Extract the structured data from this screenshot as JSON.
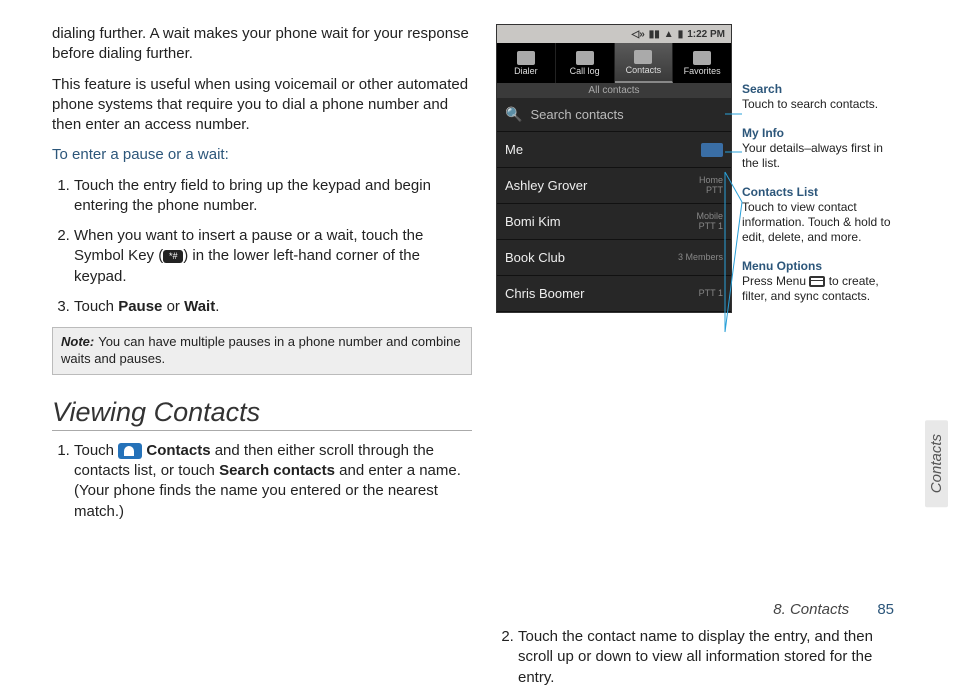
{
  "left": {
    "p1": "dialing further. A wait makes your phone wait for your response before dialing further.",
    "p2": "This feature is useful when using voicemail or other automated phone systems that require you to dial a phone number and then enter an access number.",
    "instr": "To enter a pause or a wait:",
    "steps": [
      "Touch the entry field to bring up the keypad and begin entering the phone number.",
      "When you want to insert a pause or a wait, touch the Symbol Key (",
      ") in the lower left-hand corner of the keypad.",
      "Touch ",
      "Pause",
      " or ",
      "Wait",
      "."
    ],
    "note_label": "Note:",
    "note_text": "You can have multiple pauses in a phone number and combine waits and pauses.",
    "heading": "Viewing Contacts",
    "view_steps_a": "Touch ",
    "view_steps_b": " Contacts",
    "view_steps_c": " and then either scroll through the contacts list, or touch ",
    "view_steps_d": "Search contacts",
    "view_steps_e": " and enter a name. (Your phone finds the name you entered or the nearest match.)"
  },
  "phone": {
    "time": "1:22 PM",
    "tabs": [
      "Dialer",
      "Call log",
      "Contacts",
      "Favorites"
    ],
    "subheader": "All contacts",
    "search_placeholder": "Search contacts",
    "rows": [
      {
        "name": "Me",
        "tag": ""
      },
      {
        "name": "Ashley Grover",
        "tag": "Home\nPTT"
      },
      {
        "name": "Bomi Kim",
        "tag": "Mobile\nPTT 1"
      },
      {
        "name": "Book Club",
        "tag": "3 Members"
      },
      {
        "name": "Chris Boomer",
        "tag": "PTT 1"
      }
    ]
  },
  "callouts": [
    {
      "title": "Search",
      "body": "Touch to search contacts."
    },
    {
      "title": "My Info",
      "body": "Your details–always first in the list."
    },
    {
      "title": "Contacts  List",
      "body": "Touch to view contact information. Touch & hold to edit, delete, and more."
    },
    {
      "title": "Menu Options",
      "body_a": "Press Menu ",
      "body_b": " to create, filter, and sync contacts."
    }
  ],
  "right_step2": "Touch the contact name to display the entry, and then scroll up or down to view all information stored for the entry.",
  "side_tab": "Contacts",
  "footer_chapter": "8. Contacts",
  "footer_page": "85"
}
